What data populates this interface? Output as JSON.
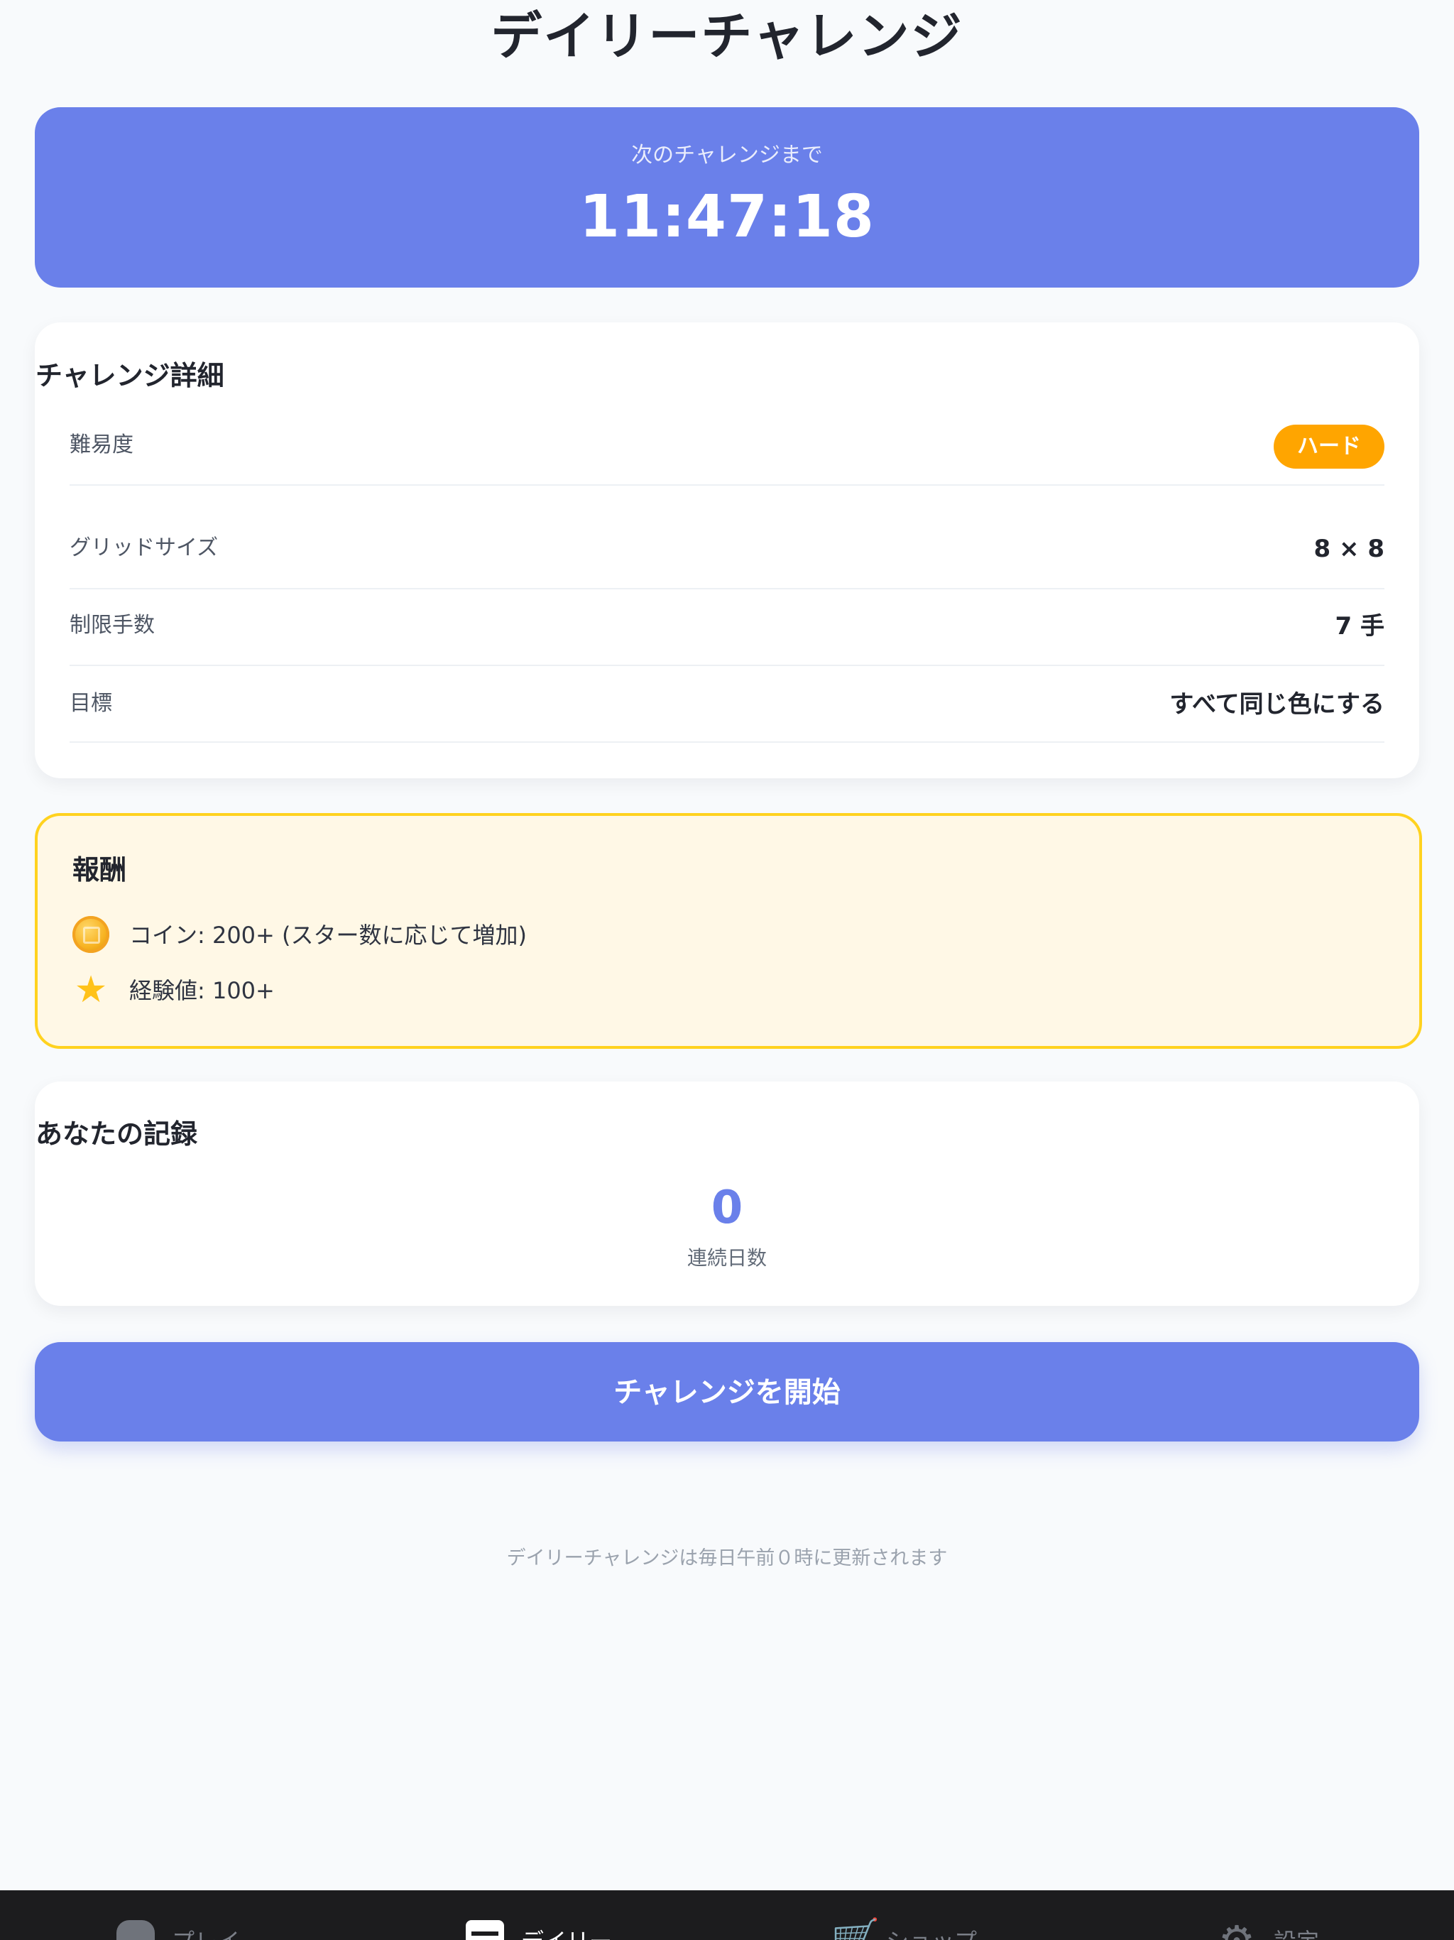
{
  "page": {
    "title": "デイリーチャレンジ"
  },
  "timer": {
    "label": "次のチャレンジまで",
    "value": "11:47:18"
  },
  "details": {
    "title": "チャレンジ詳細",
    "rows": [
      {
        "label": "難易度",
        "value": "ハード"
      },
      {
        "label": "グリッドサイズ",
        "value": "8 × 8"
      },
      {
        "label": "制限手数",
        "value": "7 手"
      },
      {
        "label": "目標",
        "value": "すべて同じ色にする"
      }
    ]
  },
  "rewards": {
    "title": "報酬",
    "items": [
      {
        "icon": "coin-icon",
        "text": "コイン: 200+ (スター数に応じて増加)"
      },
      {
        "icon": "star-icon",
        "text": "経験値: 100+"
      }
    ]
  },
  "record": {
    "title": "あなたの記録",
    "streak_value": "0",
    "streak_label": "連続日数"
  },
  "start_button": {
    "label": "チャレンジを開始"
  },
  "footer": {
    "note": "デイリーチャレンジは毎日午前０時に更新されます"
  },
  "bottom_nav": {
    "items": [
      {
        "label": "プレイ",
        "icon": "controller-icon"
      },
      {
        "label": "デイリー",
        "icon": "calendar-icon"
      },
      {
        "label": "ショップ",
        "icon": "cart-icon"
      },
      {
        "label": "設定",
        "icon": "gear-icon"
      }
    ]
  },
  "colors": {
    "background": "#f8fafc",
    "primary": "#6a80ea",
    "difficulty_badge": "#ffa500",
    "reward_background": "#fff8e6",
    "reward_border": "#ffd21f",
    "bottom_nav": "#1c1c1e"
  }
}
